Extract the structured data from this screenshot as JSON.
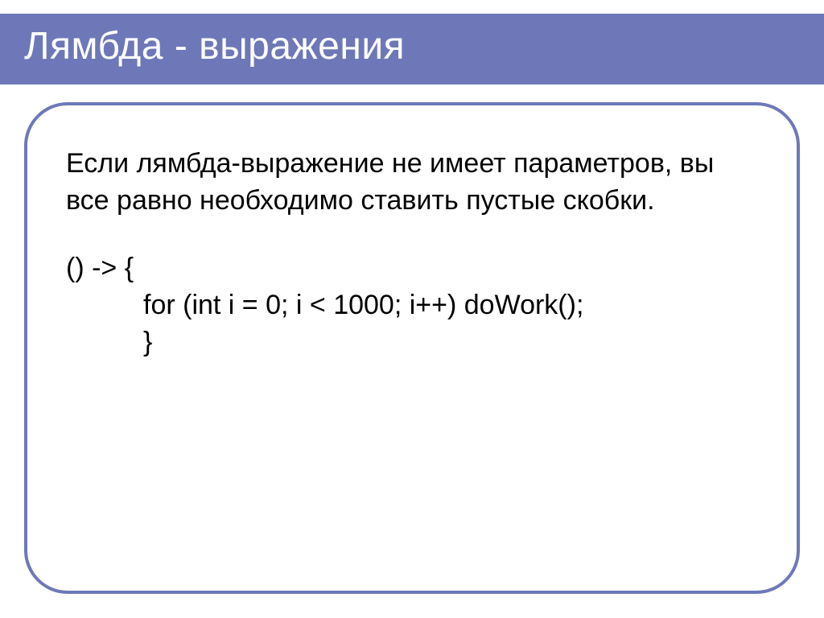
{
  "title": "Лямбда - выражения",
  "paragraph": "Если лямбда-выражение не имеет параметров, вы все равно необходимо ставить пустые скобки.",
  "code": {
    "line1": "() -> {",
    "line2": "for (int i = 0; i < 1000; i++) doWork();",
    "line3": "}"
  }
}
